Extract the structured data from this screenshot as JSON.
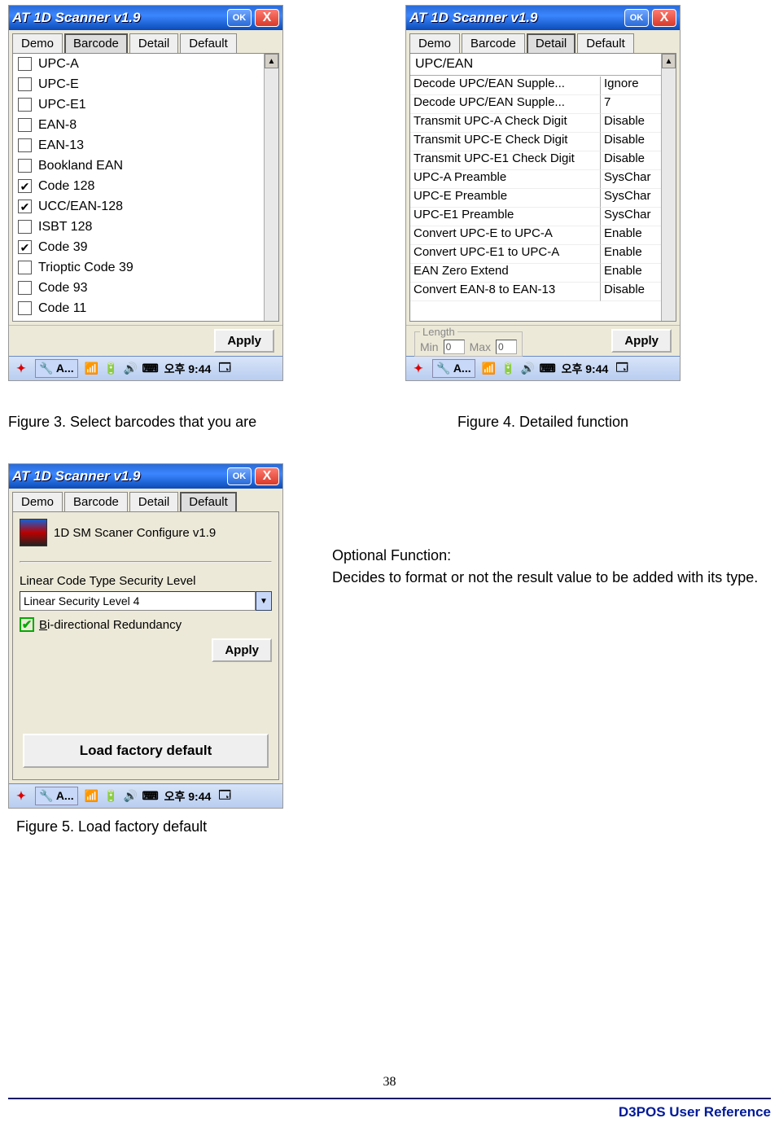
{
  "app_title": "AT 1D Scanner v1.9",
  "titlebar": {
    "ok": "OK",
    "close": "X"
  },
  "tabs": {
    "demo": "Demo",
    "barcode": "Barcode",
    "detail": "Detail",
    "default": "Default"
  },
  "apply_label": "Apply",
  "taskbar": {
    "app": "A...",
    "time": "오후 9:44"
  },
  "fig3": {
    "caption": "Figure 3. Select barcodes that you are",
    "items": [
      {
        "label": "UPC-A",
        "checked": false
      },
      {
        "label": "UPC-E",
        "checked": false
      },
      {
        "label": "UPC-E1",
        "checked": false
      },
      {
        "label": "EAN-8",
        "checked": false
      },
      {
        "label": "EAN-13",
        "checked": false
      },
      {
        "label": "Bookland EAN",
        "checked": false
      },
      {
        "label": "Code 128",
        "checked": true
      },
      {
        "label": "UCC/EAN-128",
        "checked": true
      },
      {
        "label": "ISBT 128",
        "checked": false
      },
      {
        "label": "Code 39",
        "checked": true
      },
      {
        "label": "Trioptic Code 39",
        "checked": false
      },
      {
        "label": "Code 93",
        "checked": false
      },
      {
        "label": "Code 11",
        "checked": false
      }
    ]
  },
  "fig4": {
    "caption": "Figure 4. Detailed function",
    "section": "UPC/EAN",
    "length": {
      "group": "Length",
      "min_label": "Min",
      "min_value": "0",
      "max_label": "Max",
      "max_value": "0"
    },
    "rows": [
      {
        "name": "Decode UPC/EAN Supple...",
        "value": "Ignore"
      },
      {
        "name": "Decode UPC/EAN Supple...",
        "value": "7"
      },
      {
        "name": "Transmit UPC-A Check Digit",
        "value": "Disable"
      },
      {
        "name": "Transmit UPC-E Check Digit",
        "value": "Disable"
      },
      {
        "name": "Transmit UPC-E1 Check Digit",
        "value": "Disable"
      },
      {
        "name": "UPC-A Preamble",
        "value": "SysChar"
      },
      {
        "name": "UPC-E Preamble",
        "value": "SysChar"
      },
      {
        "name": "UPC-E1 Preamble",
        "value": "SysChar"
      },
      {
        "name": "Convert UPC-E to UPC-A",
        "value": "Enable"
      },
      {
        "name": "Convert UPC-E1 to UPC-A",
        "value": "Enable"
      },
      {
        "name": "EAN Zero Extend",
        "value": "Enable"
      },
      {
        "name": "Convert EAN-8 to EAN-13",
        "value": "Disable"
      }
    ]
  },
  "fig5": {
    "caption": "Figure 5. Load factory default",
    "config_title": "1D SM Scaner Configure v1.9",
    "group_label": "Linear Code Type Security Level",
    "combo_value": "Linear Security Level 4",
    "checkbox_label": "Bi-directional Redundancy",
    "factory_button": "Load factory default"
  },
  "side_text": {
    "heading": "Optional Function:",
    "body": "Decides to format or not the result value to be added with its type."
  },
  "footer": {
    "page_number": "38",
    "reference": "D3POS User Reference"
  }
}
